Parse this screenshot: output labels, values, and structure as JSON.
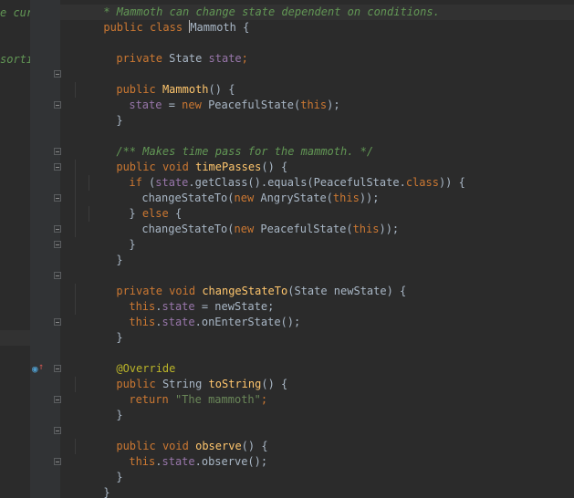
{
  "editor": {
    "left_fragments": {
      "top": "e cur",
      "mid": "sorti"
    },
    "top_comment": "* Mammoth can change state dependent on conditions.",
    "lines": {
      "class_kw1": "public",
      "class_kw2": "class",
      "class_name": "Mammoth",
      "class_brace": "{",
      "f_private": "private",
      "f_type": "State",
      "f_name": "state",
      "f_semi": ";",
      "c_public": "public",
      "c_name": "Mammoth",
      "c_sig": "() {",
      "c_body_field": "state",
      "c_body_eq": " = ",
      "c_body_new": "new",
      "c_body_call": " PeacefulState(",
      "c_body_this": "this",
      "c_body_end": ");",
      "close1": "}",
      "doc": "/** Makes time pass for the mammoth. */",
      "tp_public": "public",
      "tp_void": "void",
      "tp_name": "timePasses",
      "tp_sig": "() {",
      "if_kw": "if",
      "if_open": " (",
      "if_field": "state",
      "if_mid": ".getClass().equals(PeacefulState.",
      "if_class": "class",
      "if_end": ")) {",
      "cst1_call": "changeStateTo(",
      "cst1_new": "new",
      "cst1_type": " AngryState(",
      "cst1_this": "this",
      "cst1_end": "));",
      "else_open": "} ",
      "else_kw": "else",
      "else_brace": " {",
      "cst2_call": "changeStateTo(",
      "cst2_new": "new",
      "cst2_type": " PeacefulState(",
      "cst2_this": "this",
      "cst2_end": "));",
      "close_if": "}",
      "close_tp": "}",
      "cs_private": "private",
      "cs_void": "void",
      "cs_name": "changeStateTo",
      "cs_sig": "(State newState) {",
      "cs1_this": "this",
      "cs1_dot": ".",
      "cs1_field": "state",
      "cs1_rest": " = newState;",
      "cs2_this": "this",
      "cs2_dot": ".",
      "cs2_field": "state",
      "cs2_rest": ".onEnterState();",
      "close_cs": "}",
      "annotation": "@Override",
      "ts_public": "public",
      "ts_type": "String",
      "ts_name": "toString",
      "ts_sig": "() {",
      "ret_kw": "return",
      "ret_str": "\"The mammoth\"",
      "ret_semi": ";",
      "close_ts": "}",
      "ob_public": "public",
      "ob_void": "void",
      "ob_name": "observe",
      "ob_sig": "() {",
      "ob1_this": "this",
      "ob1_dot": ".",
      "ob1_field": "state",
      "ob1_rest": ".observe();",
      "close_ob": "}",
      "close_class": "}"
    }
  },
  "colors": {
    "background": "#2b2b2b",
    "gutter": "#313335",
    "keyword": "#cc7832",
    "method": "#ffc66d",
    "field": "#9876aa",
    "string": "#6a8759",
    "annotation": "#bbb529",
    "comment": "#629755",
    "text": "#a9b7c6"
  },
  "icons": {
    "override": "override-gutter-icon"
  }
}
